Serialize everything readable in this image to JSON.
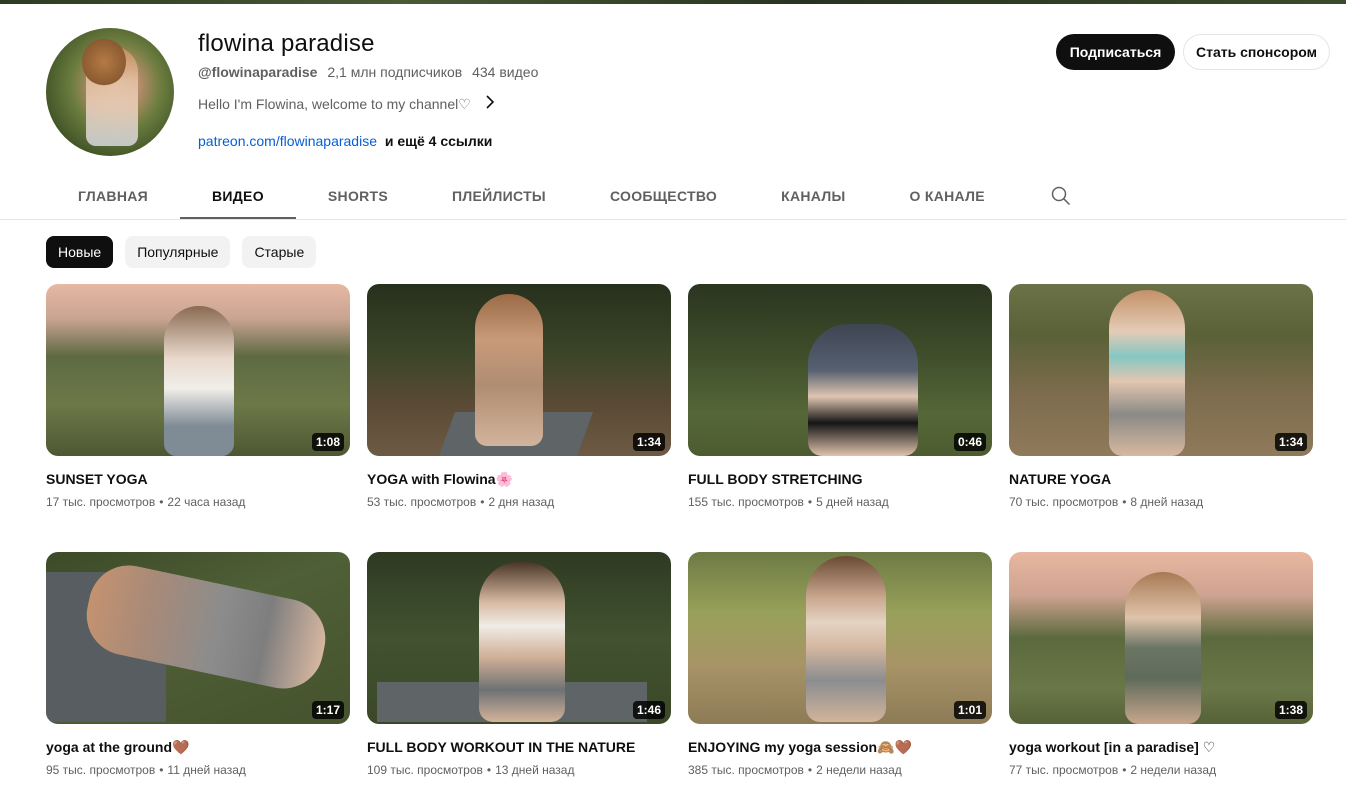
{
  "channel": {
    "name": "flowina paradise",
    "handle": "@flowinaparadise",
    "subscribers": "2,1 млн подписчиков",
    "videos_count": "434 видео",
    "description": "Hello I'm Flowina, welcome to my channel♡",
    "link": "patreon.com/flowinaparadise",
    "more_links": "и ещё 4 ссылки"
  },
  "actions": {
    "subscribe": "Подписаться",
    "sponsor": "Стать спонсором"
  },
  "tabs": [
    {
      "label": "ГЛАВНАЯ"
    },
    {
      "label": "ВИДЕО"
    },
    {
      "label": "SHORTS"
    },
    {
      "label": "ПЛЕЙЛИСТЫ"
    },
    {
      "label": "СООБЩЕСТВО"
    },
    {
      "label": "КАНАЛЫ"
    },
    {
      "label": "О КАНАЛЕ"
    }
  ],
  "active_tab": "ВИДЕО",
  "filters": [
    {
      "label": "Новые"
    },
    {
      "label": "Популярные"
    },
    {
      "label": "Старые"
    }
  ],
  "active_filter": "Новые",
  "videos": [
    {
      "title": "SUNSET YOGA",
      "views": "17 тыс. просмотров",
      "age": "22 часа назад",
      "duration": "1:08"
    },
    {
      "title": "YOGA with Flowina🌸",
      "views": "53 тыс. просмотров",
      "age": "2 дня назад",
      "duration": "1:34"
    },
    {
      "title": "FULL BODY STRETCHING",
      "views": "155 тыс. просмотров",
      "age": "5 дней назад",
      "duration": "0:46"
    },
    {
      "title": "NATURE YOGA",
      "views": "70 тыс. просмотров",
      "age": "8 дней назад",
      "duration": "1:34"
    },
    {
      "title": "yoga at the ground🤎",
      "views": "95 тыс. просмотров",
      "age": "11 дней назад",
      "duration": "1:17"
    },
    {
      "title": "FULL BODY WORKOUT IN THE NATURE",
      "views": "109 тыс. просмотров",
      "age": "13 дней назад",
      "duration": "1:46"
    },
    {
      "title": "ENJOYING my yoga session🙈🤎",
      "views": "385 тыс. просмотров",
      "age": "2 недели назад",
      "duration": "1:01"
    },
    {
      "title": "yoga workout [in a paradise] ♡",
      "views": "77 тыс. просмотров",
      "age": "2 недели назад",
      "duration": "1:38"
    }
  ],
  "icons": {
    "search": "search-icon",
    "chevron": "chevron-right-icon"
  },
  "colors": {
    "link": "#065fd4",
    "primary_button": "#0f0f0f",
    "secondary_text": "#606060"
  }
}
